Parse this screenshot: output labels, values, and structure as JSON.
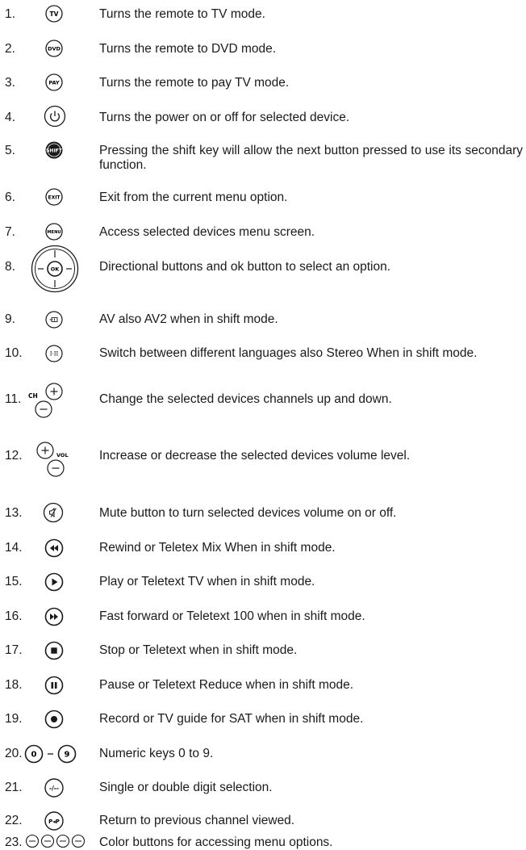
{
  "items": [
    {
      "number": "1.",
      "icon": "tv-mode-button-icon",
      "icon_text": "TV",
      "desc": "Turns the remote to TV mode."
    },
    {
      "number": "2.",
      "icon": "dvd-mode-button-icon",
      "icon_text": "DVD",
      "desc": "Turns the remote to DVD mode."
    },
    {
      "number": "3.",
      "icon": "pay-tv-mode-button-icon",
      "icon_text": "PAY",
      "desc": "Turns the remote to pay TV mode."
    },
    {
      "number": "4.",
      "icon": "power-button-icon",
      "desc": "Turns the power on or off for selected device."
    },
    {
      "number": "5.",
      "icon": "shift-button-icon",
      "icon_text": "SHIFT",
      "desc": "Pressing the shift key will allow the next button pressed to use its secondary function."
    },
    {
      "number": "6.",
      "icon": "exit-button-icon",
      "icon_text": "EXIT",
      "desc": "Exit from the current menu option."
    },
    {
      "number": "7.",
      "icon": "menu-button-icon",
      "icon_text": "MENU",
      "desc": "Access selected devices menu screen."
    },
    {
      "number": "8.",
      "icon": "directional-ok-pad-icon",
      "icon_text": "OK",
      "desc": "Directional buttons and ok button to select an option."
    },
    {
      "number": "9.",
      "icon": "av-input-button-icon",
      "desc": "AV also AV2 when in shift mode."
    },
    {
      "number": "10.",
      "icon": "language-button-icon",
      "icon_text": "I·II",
      "desc": "Switch between different languages also Stereo When in shift mode."
    },
    {
      "number": "11.",
      "icon": "channel-up-down-icon",
      "icon_text": "CH",
      "desc": "Change the selected devices channels up and down."
    },
    {
      "number": "12.",
      "icon": "volume-up-down-icon",
      "icon_text": "VOL",
      "desc": "Increase or decrease the selected devices volume level."
    },
    {
      "number": "13.",
      "icon": "mute-button-icon",
      "desc": "Mute button to turn selected devices volume on or off."
    },
    {
      "number": "14.",
      "icon": "rewind-button-icon",
      "desc": "Rewind or Teletex Mix When in shift mode."
    },
    {
      "number": "15.",
      "icon": "play-button-icon",
      "desc": "Play or Teletext TV when in shift mode."
    },
    {
      "number": "16.",
      "icon": "fast-forward-button-icon",
      "desc": "Fast forward or Teletext 100 when in shift mode."
    },
    {
      "number": "17.",
      "icon": "stop-button-icon",
      "desc": "Stop or Teletext when in shift mode."
    },
    {
      "number": "18.",
      "icon": "pause-button-icon",
      "desc": "Pause or Teletext Reduce when in shift mode."
    },
    {
      "number": "19.",
      "icon": "record-button-icon",
      "desc": "Record or TV guide for SAT when in shift mode."
    },
    {
      "number": "20.",
      "icon": "numeric-keys-icon",
      "icon_text_a": "0",
      "icon_text_b": "9",
      "desc": "Numeric keys 0 to 9."
    },
    {
      "number": "21.",
      "icon": "digit-select-button-icon",
      "icon_text": "-/--",
      "desc": "Single or double digit selection."
    },
    {
      "number": "22.",
      "icon": "previous-channel-button-icon",
      "icon_text": "P◂P",
      "desc": "Return to previous channel viewed."
    },
    {
      "number": "23.",
      "icon": "color-buttons-icon",
      "desc": "Color buttons for accessing menu options."
    }
  ]
}
